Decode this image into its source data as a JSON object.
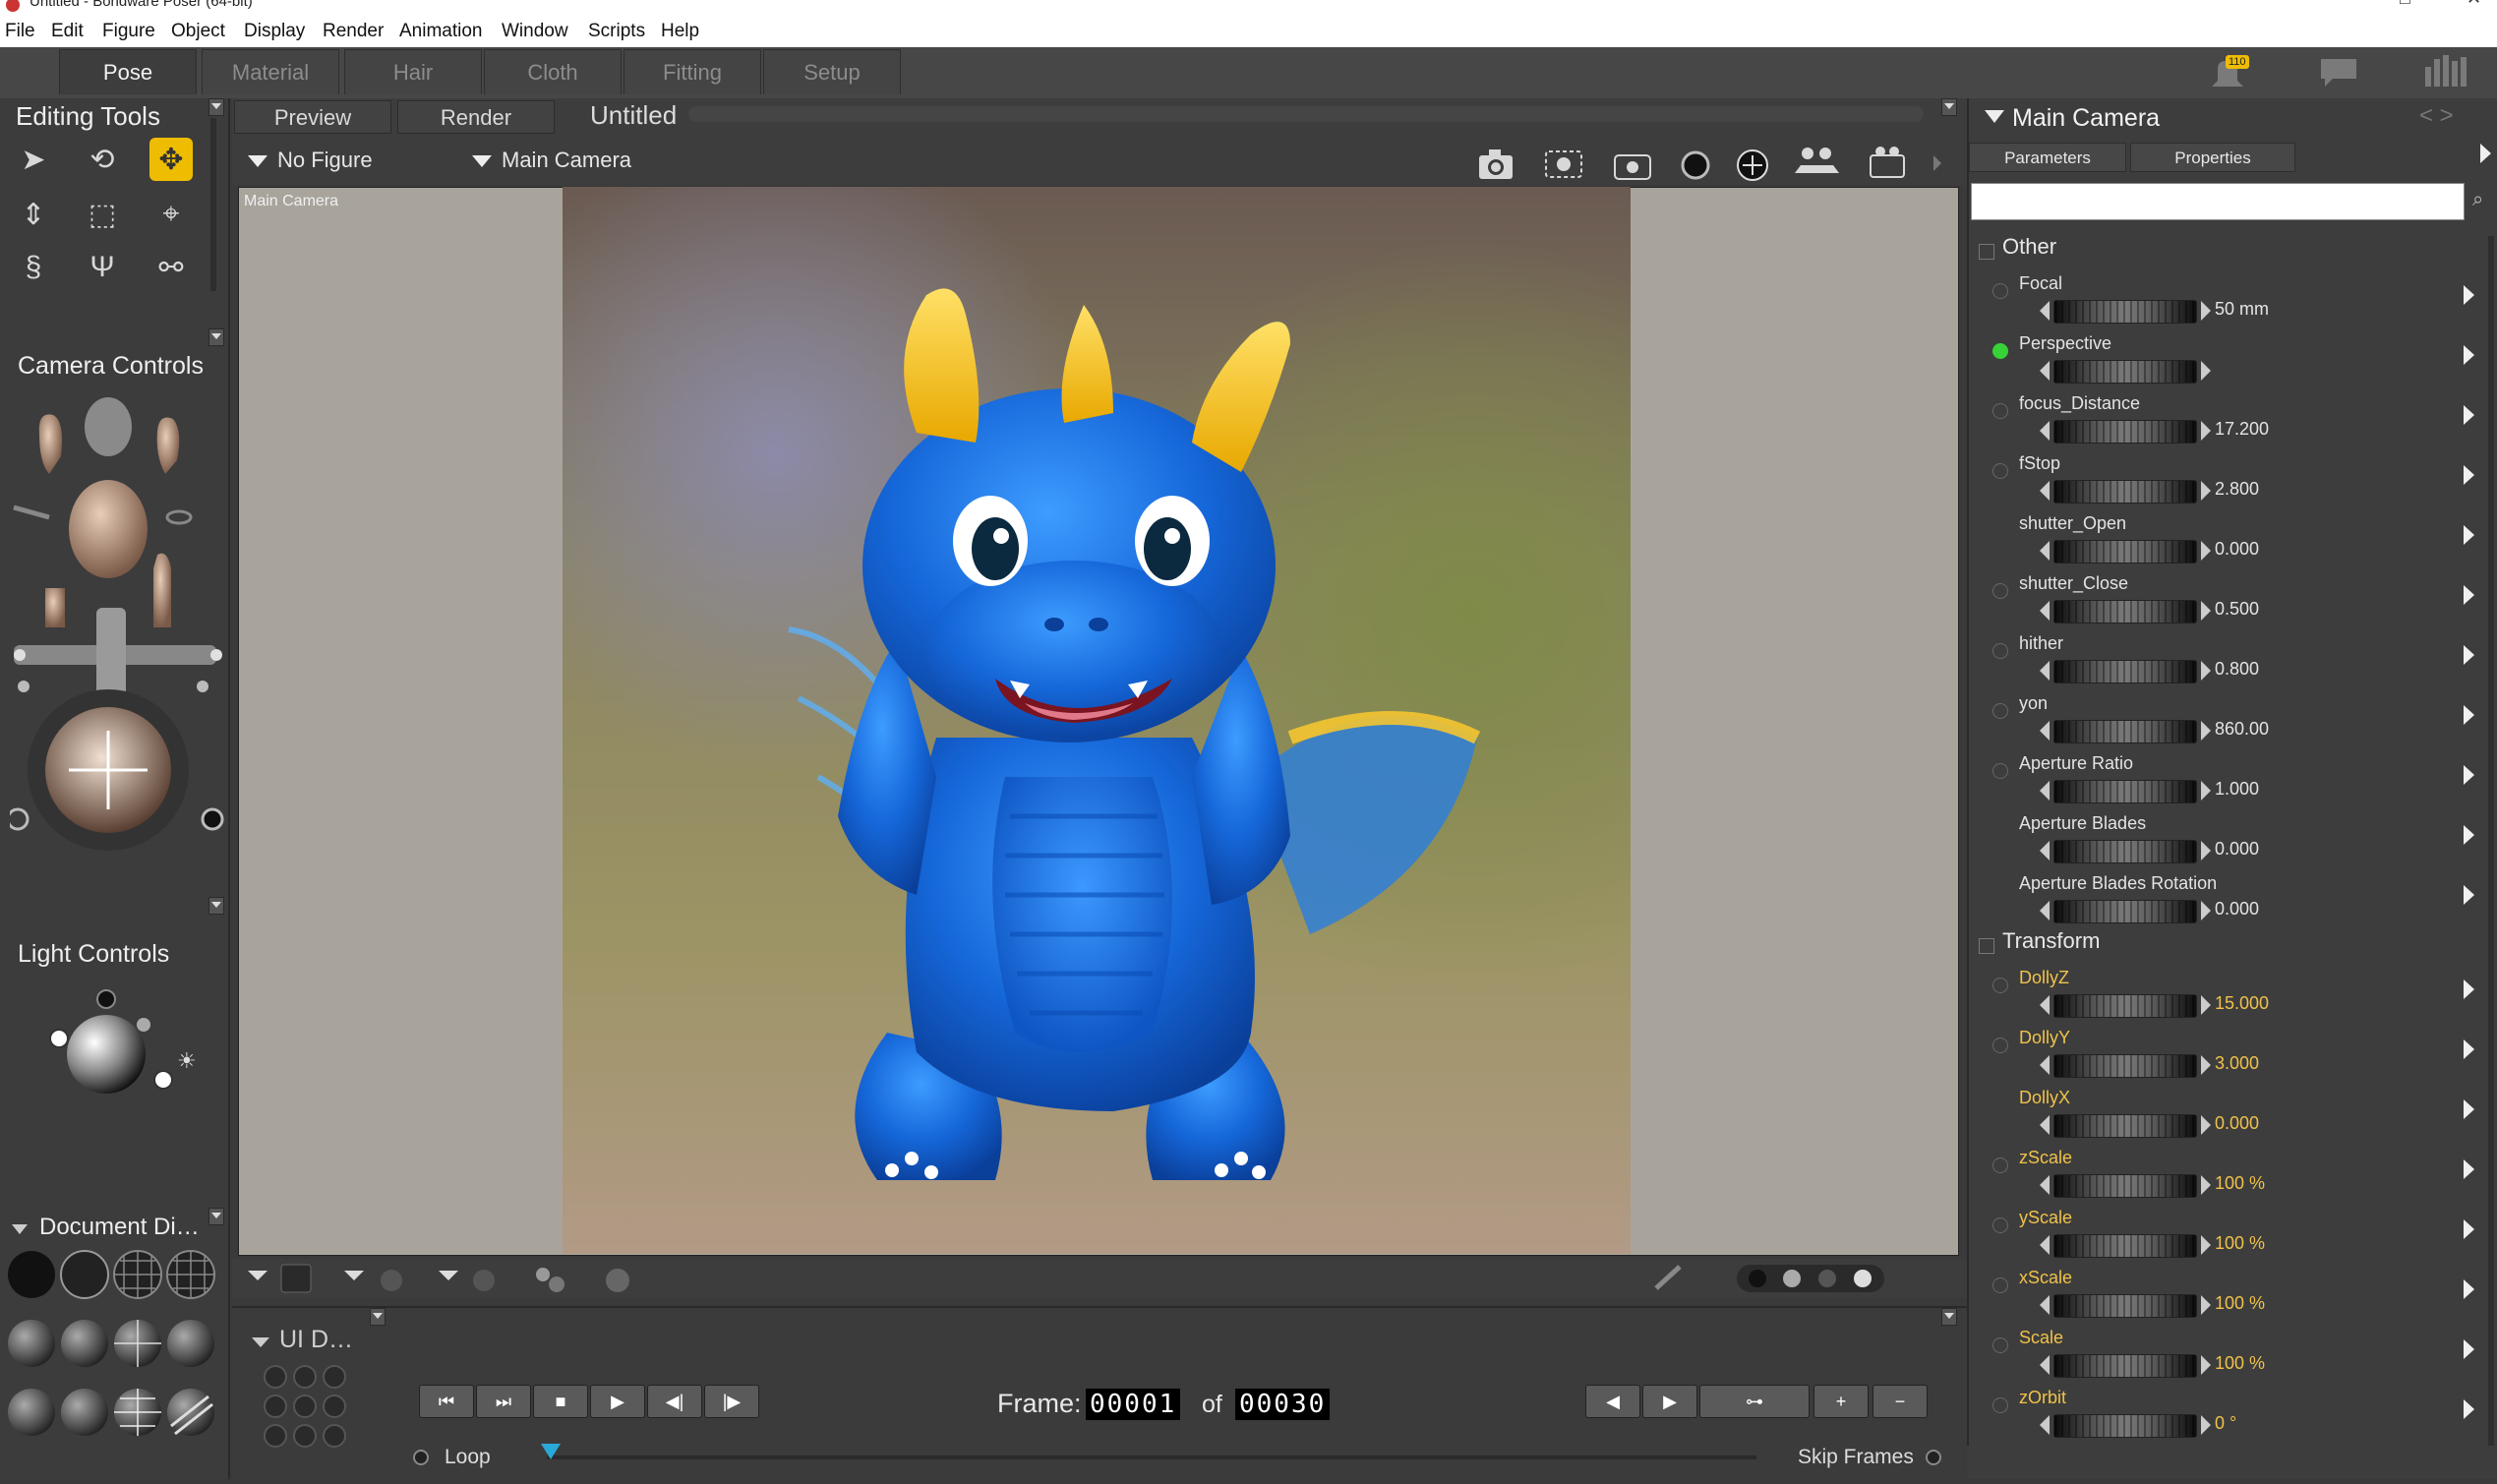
{
  "window": {
    "title": "Untitled - Bondware Poser (64-bit)"
  },
  "menu": [
    "File",
    "Edit",
    "Figure",
    "Object",
    "Display",
    "Render",
    "Animation",
    "Window",
    "Scripts",
    "Help"
  ],
  "rooms": [
    "Pose",
    "Material",
    "Hair",
    "Cloth",
    "Fitting",
    "Setup"
  ],
  "notifications": {
    "count": "110"
  },
  "left": {
    "editing_tools": "Editing Tools",
    "camera_controls": "Camera Controls",
    "light_controls": "Light Controls",
    "document_display": "Document Di…"
  },
  "document": {
    "tabs": [
      "Preview",
      "Render"
    ],
    "title": "Untitled",
    "figure_select": "No Figure",
    "camera_select": "Main Camera",
    "viewport_label": "Main Camera"
  },
  "timeline": {
    "ui_dots": "UI D…",
    "frame_label": "Frame:",
    "frame": "00001",
    "of_label": "of",
    "total": "00030",
    "loop": "Loop",
    "skip": "Skip Frames"
  },
  "right": {
    "title": "Main Camera",
    "tabs": [
      "Parameters",
      "Properties"
    ],
    "groups": [
      "Other",
      "Transform"
    ],
    "other": [
      {
        "name": "Focal",
        "value": "50 mm"
      },
      {
        "name": "Perspective",
        "value": ""
      },
      {
        "name": "focus_Distance",
        "value": "17.200"
      },
      {
        "name": "fStop",
        "value": "2.800"
      },
      {
        "name": "shutter_Open",
        "value": "0.000"
      },
      {
        "name": "shutter_Close",
        "value": "0.500"
      },
      {
        "name": "hither",
        "value": "0.800"
      },
      {
        "name": "yon",
        "value": "860.00"
      },
      {
        "name": "Aperture Ratio",
        "value": "1.000"
      },
      {
        "name": "Aperture Blades",
        "value": "0.000"
      },
      {
        "name": "Aperture Blades Rotation",
        "value": "0.000"
      }
    ],
    "transform": [
      {
        "name": "DollyZ",
        "value": "15.000"
      },
      {
        "name": "DollyY",
        "value": "3.000"
      },
      {
        "name": "DollyX",
        "value": "0.000"
      },
      {
        "name": "zScale",
        "value": "100 %"
      },
      {
        "name": "yScale",
        "value": "100 %"
      },
      {
        "name": "xScale",
        "value": "100 %"
      },
      {
        "name": "Scale",
        "value": "100 %"
      },
      {
        "name": "zOrbit",
        "value": "0 °"
      }
    ]
  },
  "colors": {
    "accent": "#eebc00",
    "param_gold": "#f0c24a",
    "active_radio": "#37d237",
    "dragon_blue": "#1a6fe0",
    "dragon_horn": "#f4c430"
  }
}
